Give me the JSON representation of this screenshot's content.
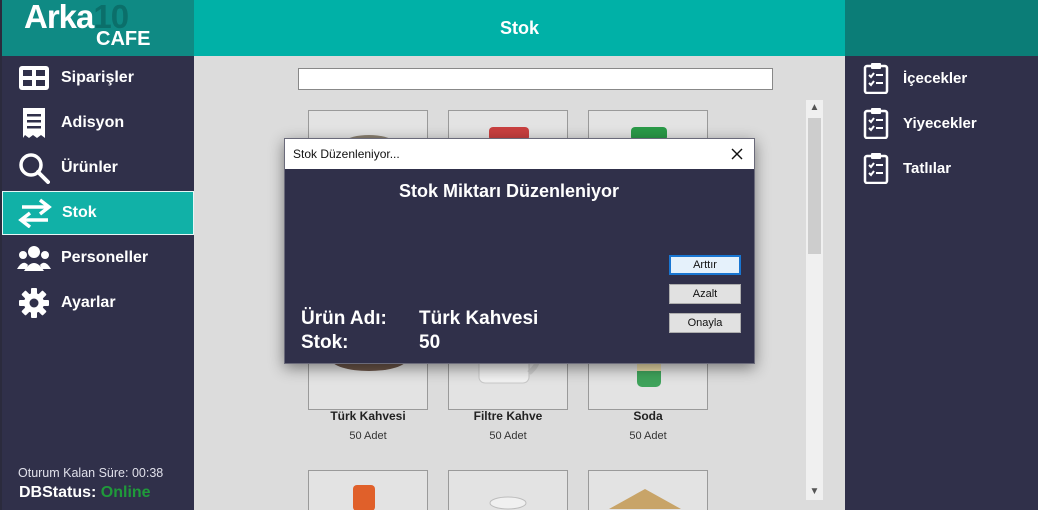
{
  "app": {
    "logo_main": "Arka",
    "logo_num": "10",
    "logo_sub": "CAFE",
    "title": "Stok"
  },
  "sidebar": {
    "items": [
      {
        "label": "Siparişler",
        "icon": "table-icon"
      },
      {
        "label": "Adisyon",
        "icon": "receipt-icon"
      },
      {
        "label": "Ürünler",
        "icon": "search-icon"
      },
      {
        "label": "Stok",
        "icon": "swap-arrows-icon"
      },
      {
        "label": "Personeller",
        "icon": "users-icon"
      },
      {
        "label": "Ayarlar",
        "icon": "gear-icon"
      }
    ],
    "session_text": "Oturum Kalan Süre: 00:38",
    "db_label": "DBStatus:",
    "db_value": "Online"
  },
  "categories": {
    "items": [
      {
        "label": "İçecekler",
        "icon": "clipboard-icon"
      },
      {
        "label": "Yiyecekler",
        "icon": "clipboard-icon"
      },
      {
        "label": "Tatlılar",
        "icon": "clipboard-icon"
      }
    ]
  },
  "products": [
    {
      "name": "Türk Kahvesi",
      "qty": "50 Adet"
    },
    {
      "name": "Filtre Kahve",
      "qty": "50 Adet"
    },
    {
      "name": "Soda",
      "qty": "50 Adet"
    }
  ],
  "dialog": {
    "window_title": "Stok Düzenleniyor...",
    "heading": "Stok Miktarı Düzenleniyor",
    "buttons": {
      "increase": "Arttır",
      "decrease": "Azalt",
      "confirm": "Onayla"
    },
    "product_label": "Ürün Adı:",
    "product_value": "Türk Kahvesi",
    "stock_label": "Stok:",
    "stock_value": "50"
  },
  "colors": {
    "accent": "#00b1a7",
    "sidebar_bg": "#30304a",
    "online": "#1f9a3a"
  }
}
